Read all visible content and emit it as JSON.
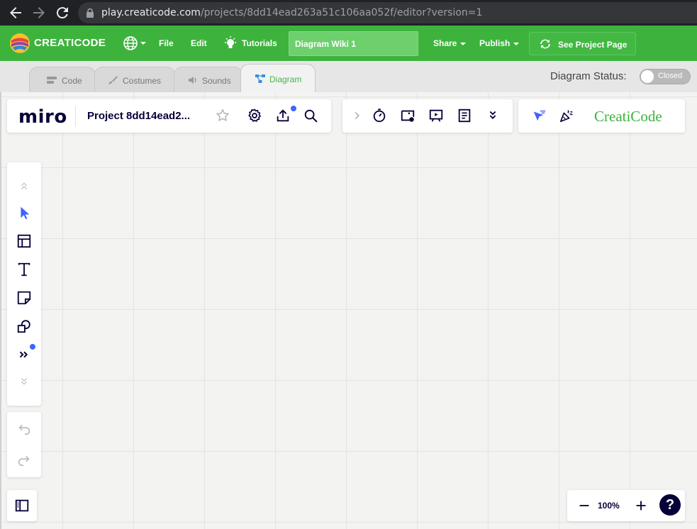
{
  "browser": {
    "url_host": "play.creaticode.com",
    "url_path": "/projects/8dd14ead263a51c106aa052f/editor?version=1",
    "icons": [
      "back-arrow-icon",
      "forward-arrow-icon",
      "reload-icon",
      "lock-icon"
    ]
  },
  "header": {
    "logo_text": "CREATICODE",
    "menu": {
      "file": "File",
      "edit": "Edit",
      "tutorials": "Tutorials",
      "share": "Share",
      "publish": "Publish"
    },
    "project_title": "Diagram Wiki 1",
    "see_project_label": "See Project Page",
    "colors": {
      "header_bg": "#3db33d",
      "title_box_bg": "#6dd06d"
    }
  },
  "tabs": {
    "items": [
      {
        "label": "Code",
        "icon": "code-icon",
        "active": false
      },
      {
        "label": "Costumes",
        "icon": "paintbrush-icon",
        "active": false
      },
      {
        "label": "Sounds",
        "icon": "speaker-icon",
        "active": false
      },
      {
        "label": "Diagram",
        "icon": "diagram-icon",
        "active": true
      }
    ],
    "diagram_status_label": "Diagram Status:",
    "diagram_status_value": "Closed"
  },
  "miro": {
    "logo": "miro",
    "board_name": "Project 8dd14ead2...",
    "top_left_icons": [
      "star-icon",
      "settings-icon",
      "share-upload-icon",
      "search-icon"
    ],
    "top_center_icons": [
      "chevron-right-icon",
      "timer-icon",
      "card-icon",
      "present-icon",
      "notes-icon",
      "expand-down-icon"
    ],
    "top_right_icons": [
      "cursor-filter-icon",
      "celebrate-icon"
    ],
    "brand": "CreatiCode",
    "left_tools": [
      "scroll-up-icon",
      "select-cursor-icon",
      "frame-icon",
      "text-icon",
      "sticky-note-icon",
      "shapes-icon",
      "more-tools-icon",
      "scroll-down-icon"
    ],
    "undo_redo": [
      "undo-icon",
      "redo-icon"
    ],
    "zoom": "100%",
    "help": "?",
    "colors": {
      "accent": "#4262ff",
      "ink": "#050038",
      "brand_green": "#3db33d"
    }
  }
}
